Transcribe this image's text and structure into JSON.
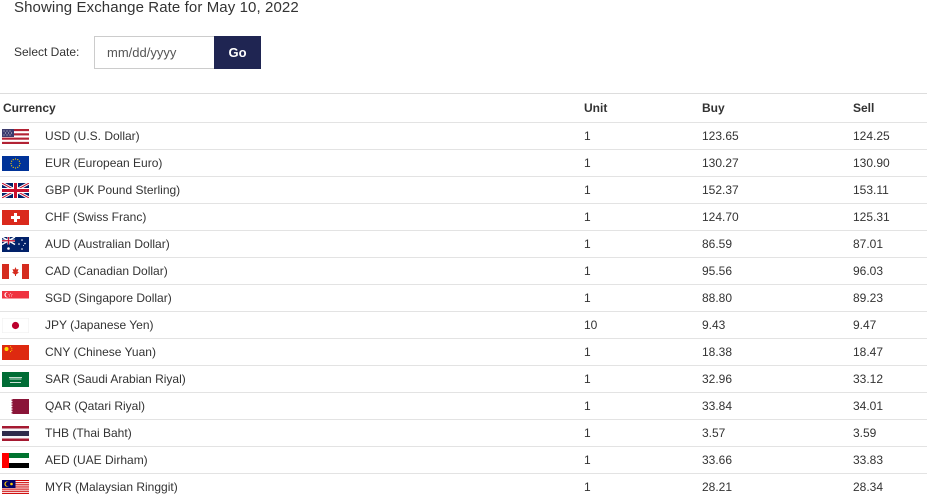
{
  "page": {
    "title": "Showing Exchange Rate for May 10, 2022"
  },
  "date_picker": {
    "label": "Select Date:",
    "placeholder": "mm/dd/yyyy",
    "value": "",
    "go_label": "Go"
  },
  "table": {
    "headers": {
      "currency": "Currency",
      "unit": "Unit",
      "buy": "Buy",
      "sell": "Sell"
    },
    "rows": [
      {
        "flag": "us-flag-icon",
        "name": "USD (U.S. Dollar)",
        "unit": "1",
        "buy": "123.65",
        "sell": "124.25"
      },
      {
        "flag": "eu-flag-icon",
        "name": "EUR (European Euro)",
        "unit": "1",
        "buy": "130.27",
        "sell": "130.90"
      },
      {
        "flag": "uk-flag-icon",
        "name": "GBP (UK Pound Sterling)",
        "unit": "1",
        "buy": "152.37",
        "sell": "153.11"
      },
      {
        "flag": "ch-flag-icon",
        "name": "CHF (Swiss Franc)",
        "unit": "1",
        "buy": "124.70",
        "sell": "125.31"
      },
      {
        "flag": "au-flag-icon",
        "name": "AUD (Australian Dollar)",
        "unit": "1",
        "buy": "86.59",
        "sell": "87.01"
      },
      {
        "flag": "ca-flag-icon",
        "name": "CAD (Canadian Dollar)",
        "unit": "1",
        "buy": "95.56",
        "sell": "96.03"
      },
      {
        "flag": "sg-flag-icon",
        "name": "SGD (Singapore Dollar)",
        "unit": "1",
        "buy": "88.80",
        "sell": "89.23"
      },
      {
        "flag": "jp-flag-icon",
        "name": "JPY (Japanese Yen)",
        "unit": "10",
        "buy": "9.43",
        "sell": "9.47"
      },
      {
        "flag": "cn-flag-icon",
        "name": "CNY (Chinese Yuan)",
        "unit": "1",
        "buy": "18.38",
        "sell": "18.47"
      },
      {
        "flag": "sa-flag-icon",
        "name": "SAR (Saudi Arabian Riyal)",
        "unit": "1",
        "buy": "32.96",
        "sell": "33.12"
      },
      {
        "flag": "qa-flag-icon",
        "name": "QAR (Qatari Riyal)",
        "unit": "1",
        "buy": "33.84",
        "sell": "34.01"
      },
      {
        "flag": "th-flag-icon",
        "name": "THB (Thai Baht)",
        "unit": "1",
        "buy": "3.57",
        "sell": "3.59"
      },
      {
        "flag": "ae-flag-icon",
        "name": "AED (UAE Dirham)",
        "unit": "1",
        "buy": "33.66",
        "sell": "33.83"
      },
      {
        "flag": "my-flag-icon",
        "name": "MYR (Malaysian Ringgit)",
        "unit": "1",
        "buy": "28.21",
        "sell": "28.34"
      }
    ]
  },
  "colors": {
    "go_button": "#1f2552",
    "text": "#333333",
    "row_border": "#e3e3e3"
  }
}
